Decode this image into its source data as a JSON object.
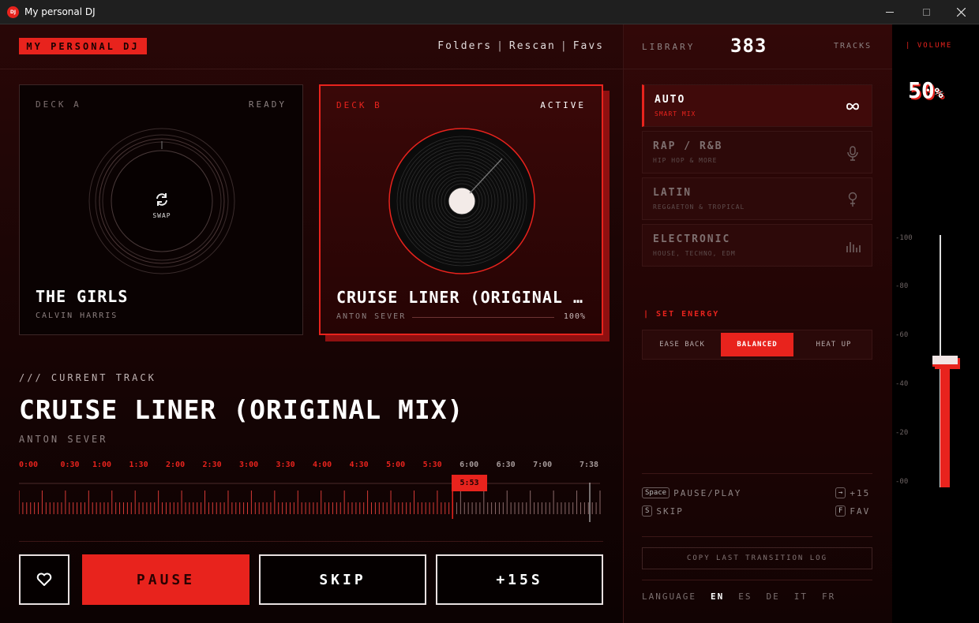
{
  "window": {
    "title": "My personal DJ",
    "icon": "DJ"
  },
  "header": {
    "brand": "MY PERSONAL DJ",
    "nav": [
      "Folders",
      "Rescan",
      "Favs"
    ],
    "nav_separator": "|"
  },
  "deck_a": {
    "label": "DECK A",
    "state": "READY",
    "title": "THE GIRLS",
    "artist": "CALVIN HARRIS",
    "swap_label": "SWAP"
  },
  "deck_b": {
    "label": "DECK B",
    "state": "ACTIVE",
    "title": "CRUISE LINER (ORIGINAL MI…",
    "artist": "ANTON SEVER",
    "progress": "100%",
    "progress_value": 1.0
  },
  "current_track": {
    "label": "/// CURRENT TRACK",
    "title": "CRUISE LINER (ORIGINAL MIX)",
    "artist": "ANTON SEVER"
  },
  "timeline": {
    "ticks": [
      "0:00",
      "0:30",
      "1:00",
      "1:30",
      "2:00",
      "2:30",
      "3:00",
      "3:30",
      "4:00",
      "4:30",
      "5:00",
      "5:30",
      "6:00",
      "6:30",
      "7:00",
      "7:38"
    ],
    "position": "5:53",
    "position_seconds": 353,
    "duration_seconds": 458
  },
  "controls": {
    "pause": "PAUSE",
    "skip": "SKIP",
    "plus": "+15S"
  },
  "library": {
    "label": "LIBRARY",
    "count": "383",
    "unit": "TRACKS"
  },
  "modes": [
    {
      "name": "AUTO",
      "sub": "SMART MIX",
      "icon": "infinity-icon",
      "active": true
    },
    {
      "name": "RAP / R&B",
      "sub": "HIP HOP & MORE",
      "icon": "microphone-icon",
      "active": false
    },
    {
      "name": "LATIN",
      "sub": "REGGAETON & TROPICAL",
      "icon": "maraca-icon",
      "active": false
    },
    {
      "name": "ELECTRONIC",
      "sub": "HOUSE, TECHNO, EDM",
      "icon": "equalizer-icon",
      "active": false
    }
  ],
  "energy": {
    "label": "| SET ENERGY",
    "options": [
      "EASE BACK",
      "BALANCED",
      "HEAT UP"
    ],
    "selected": "BALANCED"
  },
  "shortcuts": [
    {
      "key": "Space",
      "action": "PAUSE/PLAY"
    },
    {
      "key": "→",
      "action": "+15"
    },
    {
      "key": "S",
      "action": "SKIP"
    },
    {
      "key": "F",
      "action": "FAV"
    }
  ],
  "copy_log": "COPY LAST TRANSITION LOG",
  "language": {
    "label": "LANGUAGE",
    "options": [
      "EN",
      "ES",
      "DE",
      "IT",
      "FR"
    ],
    "selected": "EN"
  },
  "volume": {
    "label": "| VOLUME",
    "value": "50",
    "unit": "%",
    "level": 0.5,
    "ticks": [
      "-100",
      "-80",
      "-60",
      "-40",
      "-20",
      "-00"
    ]
  },
  "colors": {
    "accent": "#e8231d",
    "background": "#1b0505",
    "text": "#e8e2e2"
  }
}
